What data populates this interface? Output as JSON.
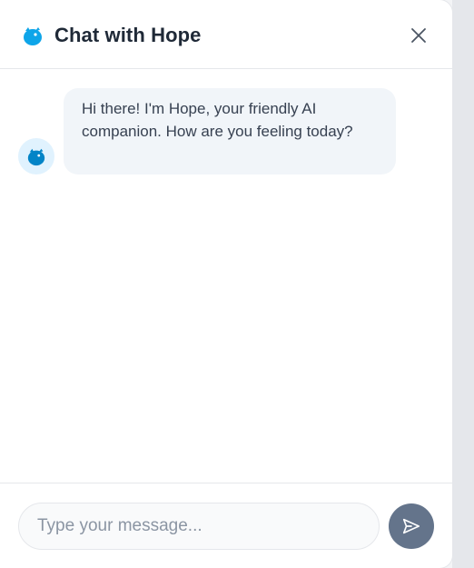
{
  "header": {
    "title": "Chat with Hope",
    "logo_icon": "bird-logo-icon",
    "close_icon": "close-icon"
  },
  "messages": [
    {
      "sender": "bot",
      "avatar_icon": "bird-avatar-icon",
      "text": "Hi there! I'm Hope, your friendly AI companion. How are you feeling today?"
    }
  ],
  "composer": {
    "placeholder": "Type your message...",
    "value": "",
    "send_icon": "send-icon"
  },
  "colors": {
    "accent": "#0ea5e9",
    "send_button": "#64748b",
    "bubble": "#f1f5f9"
  }
}
